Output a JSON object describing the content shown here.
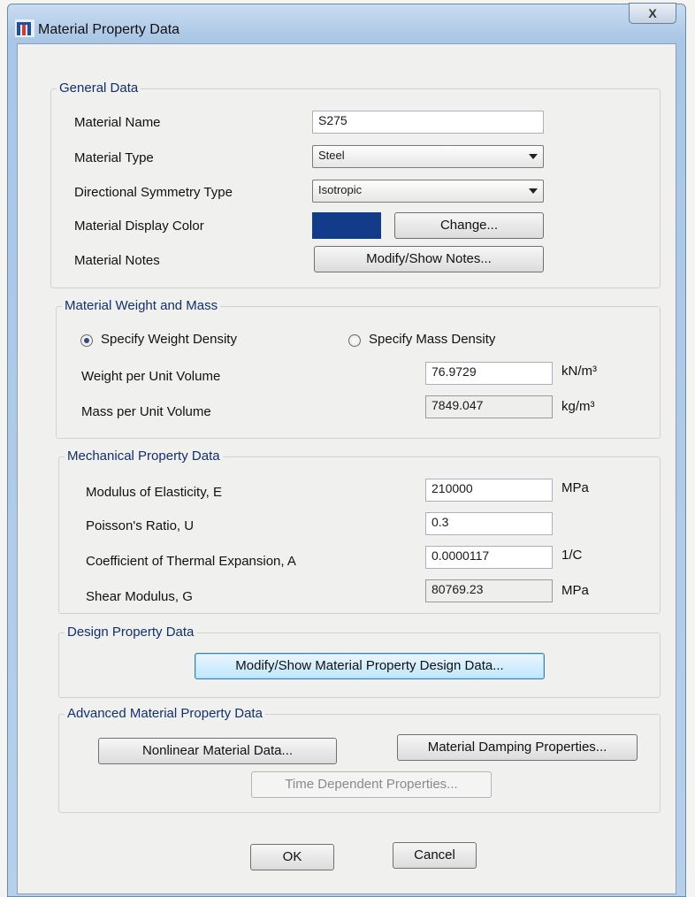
{
  "window": {
    "title": "Material Property Data",
    "close_label": "X"
  },
  "general": {
    "legend": "General Data",
    "name_label": "Material Name",
    "name_value": "S275",
    "type_label": "Material Type",
    "type_value": "Steel",
    "symmetry_label": "Directional Symmetry Type",
    "symmetry_value": "Isotropic",
    "color_label": "Material Display Color",
    "color_value": "#123c8a",
    "change_label": "Change...",
    "notes_label": "Material Notes",
    "notes_button": "Modify/Show Notes..."
  },
  "weight": {
    "legend": "Material Weight and Mass",
    "radio_weight": "Specify Weight Density",
    "radio_mass": "Specify Mass Density",
    "selected": "weight",
    "wpv_label": "Weight per Unit Volume",
    "wpv_value": "76.9729",
    "wpv_unit": "kN/m³",
    "mpv_label": "Mass per Unit Volume",
    "mpv_value": "7849.047",
    "mpv_unit": "kg/m³"
  },
  "mechanical": {
    "legend": "Mechanical Property Data",
    "e_label": "Modulus of Elasticity,  E",
    "e_value": "210000",
    "e_unit": "MPa",
    "u_label": "Poisson's Ratio,  U",
    "u_value": "0.3",
    "a_label": "Coefficient of Thermal Expansion,  A",
    "a_value": "0.0000117",
    "a_unit": "1/C",
    "g_label": "Shear Modulus,  G",
    "g_value": "80769.23",
    "g_unit": "MPa"
  },
  "design": {
    "legend": "Design Property Data",
    "button": "Modify/Show Material Property Design Data..."
  },
  "advanced": {
    "legend": "Advanced Material Property Data",
    "nonlinear": "Nonlinear Material Data...",
    "damping": "Material Damping Properties...",
    "time": "Time Dependent Properties..."
  },
  "footer": {
    "ok": "OK",
    "cancel": "Cancel"
  }
}
